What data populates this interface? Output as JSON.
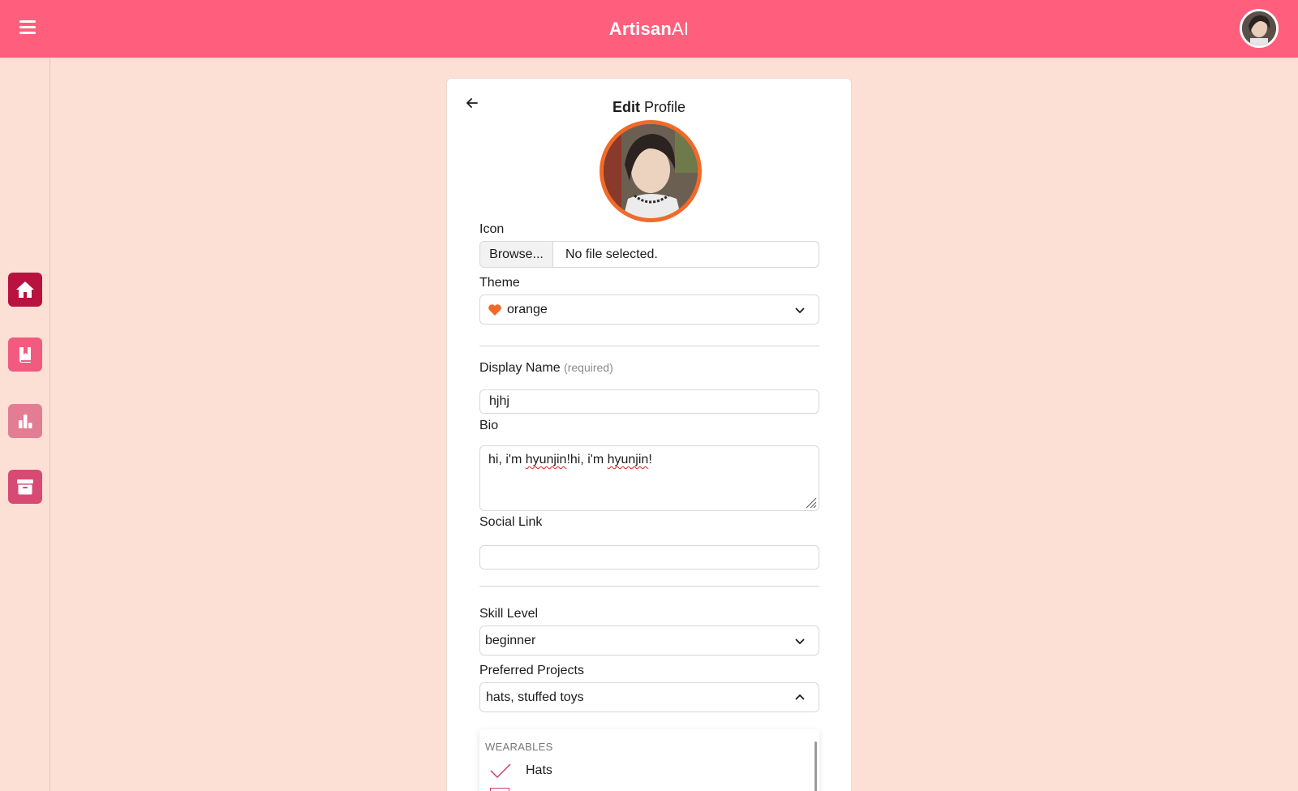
{
  "header": {
    "brand_bold": "Artisan",
    "brand_light": "AI",
    "menu_icon": "hamburger-icon",
    "avatar_icon": "user-avatar"
  },
  "sidebar": {
    "items": [
      {
        "icon": "home-icon",
        "color": "#b8123f"
      },
      {
        "icon": "bookmark-book-icon",
        "color": "#f35a80"
      },
      {
        "icon": "bar-chart-icon",
        "color": "#e27d93"
      },
      {
        "icon": "archive-box-icon",
        "color": "#d84a73"
      }
    ]
  },
  "profile": {
    "title_bold": "Edit",
    "title_rest": "Profile",
    "avatar_border_color": "#f26a2a",
    "icon_label": "Icon",
    "browse_label": "Browse...",
    "no_file_text": "No file selected.",
    "theme_label": "Theme",
    "theme_value": "orange",
    "display_name_label": "Display Name",
    "display_name_hint": "(required)",
    "display_name_value": "hjhj",
    "bio_label": "Bio",
    "bio_parts": [
      "hi, i'm ",
      "hyunjin",
      "!hi, i'm ",
      "hyunjin",
      "!"
    ],
    "social_label": "Social Link",
    "social_value": "",
    "skill_label": "Skill Level",
    "skill_value": "beginner",
    "projects_label": "Preferred Projects",
    "projects_value": "hats, stuffed toys",
    "dropdown": {
      "group": "WEARABLES",
      "items": [
        {
          "label": "Hats",
          "checked": true
        }
      ]
    }
  }
}
